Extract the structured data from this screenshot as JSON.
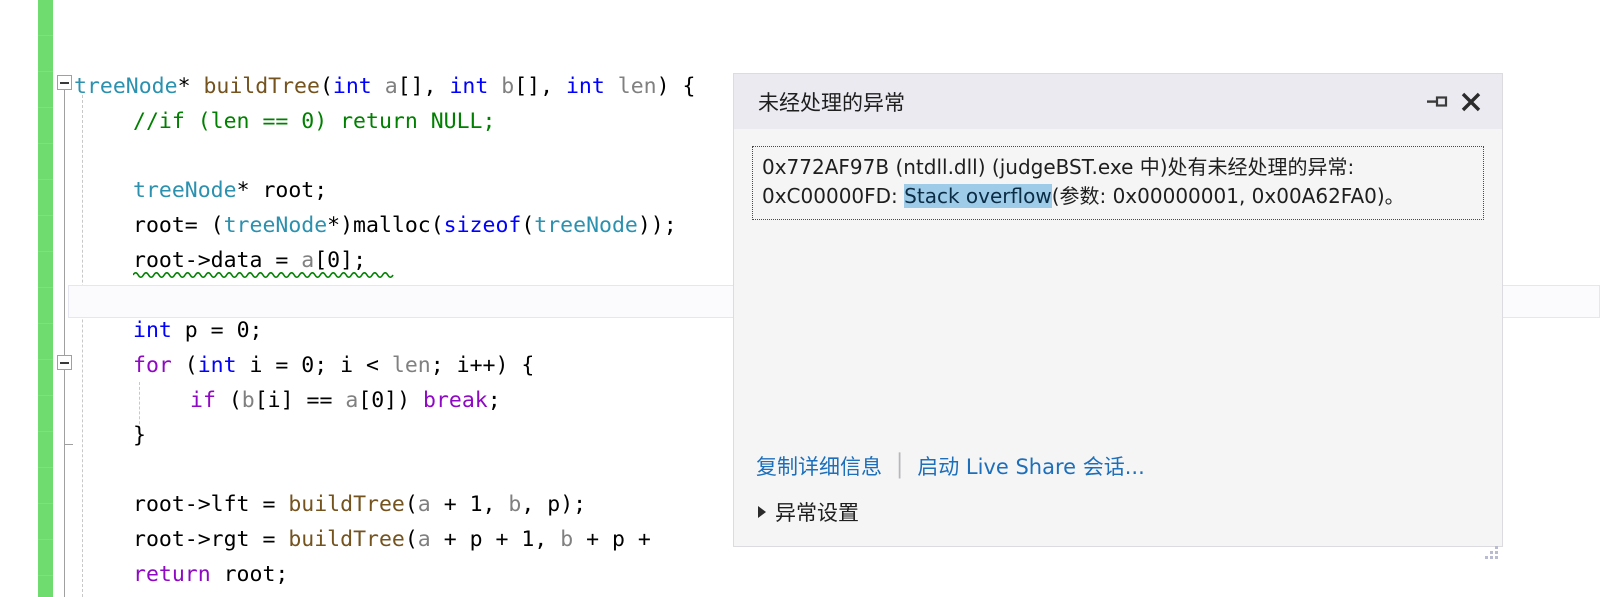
{
  "editor": {
    "language": "cpp",
    "lines": [
      {
        "indent": 0,
        "tokens": [
          {
            "t": "treeNode",
            "c": "type"
          },
          {
            "t": "* ",
            "c": "plain"
          },
          {
            "t": "buildTree",
            "c": "fn"
          },
          {
            "t": "(",
            "c": "plain"
          },
          {
            "t": "int",
            "c": "kw"
          },
          {
            "t": " ",
            "c": "plain"
          },
          {
            "t": "a",
            "c": "param"
          },
          {
            "t": "[], ",
            "c": "plain"
          },
          {
            "t": "int",
            "c": "kw"
          },
          {
            "t": " ",
            "c": "plain"
          },
          {
            "t": "b",
            "c": "param"
          },
          {
            "t": "[], ",
            "c": "plain"
          },
          {
            "t": "int",
            "c": "kw"
          },
          {
            "t": " ",
            "c": "plain"
          },
          {
            "t": "len",
            "c": "param"
          },
          {
            "t": ") {",
            "c": "plain"
          }
        ]
      },
      {
        "indent": 1,
        "tokens": [
          {
            "t": "//if (len == 0) return NULL;",
            "c": "comment"
          }
        ]
      },
      {
        "indent": 1,
        "tokens": []
      },
      {
        "indent": 1,
        "tokens": [
          {
            "t": "treeNode",
            "c": "type"
          },
          {
            "t": "* root;",
            "c": "plain"
          }
        ]
      },
      {
        "indent": 1,
        "tokens": [
          {
            "t": "root= (",
            "c": "plain"
          },
          {
            "t": "treeNode",
            "c": "type"
          },
          {
            "t": "*)malloc(",
            "c": "plain"
          },
          {
            "t": "sizeof",
            "c": "kw"
          },
          {
            "t": "(",
            "c": "plain"
          },
          {
            "t": "treeNode",
            "c": "type"
          },
          {
            "t": "));",
            "c": "plain"
          }
        ]
      },
      {
        "indent": 1,
        "tokens": [
          {
            "t": "root->data = ",
            "c": "plain"
          },
          {
            "t": "a",
            "c": "param"
          },
          {
            "t": "[0];",
            "c": "plain"
          }
        ]
      },
      {
        "indent": 1,
        "tokens": []
      },
      {
        "indent": 1,
        "tokens": [
          {
            "t": "int",
            "c": "kw"
          },
          {
            "t": " p = 0;",
            "c": "plain"
          }
        ]
      },
      {
        "indent": 1,
        "tokens": [
          {
            "t": "for",
            "c": "kw2"
          },
          {
            "t": " (",
            "c": "plain"
          },
          {
            "t": "int",
            "c": "kw"
          },
          {
            "t": " i = 0; i < ",
            "c": "plain"
          },
          {
            "t": "len",
            "c": "param"
          },
          {
            "t": "; i++) {",
            "c": "plain"
          }
        ]
      },
      {
        "indent": 2,
        "tokens": [
          {
            "t": "if",
            "c": "kw2"
          },
          {
            "t": " (",
            "c": "plain"
          },
          {
            "t": "b",
            "c": "param"
          },
          {
            "t": "[i] == ",
            "c": "plain"
          },
          {
            "t": "a",
            "c": "param"
          },
          {
            "t": "[0]) ",
            "c": "plain"
          },
          {
            "t": "break",
            "c": "kw2"
          },
          {
            "t": ";",
            "c": "plain"
          }
        ]
      },
      {
        "indent": 1,
        "tokens": [
          {
            "t": "}",
            "c": "plain"
          }
        ]
      },
      {
        "indent": 1,
        "tokens": []
      },
      {
        "indent": 1,
        "tokens": [
          {
            "t": "root->lft = ",
            "c": "plain"
          },
          {
            "t": "buildTree",
            "c": "fn"
          },
          {
            "t": "(",
            "c": "plain"
          },
          {
            "t": "a",
            "c": "param"
          },
          {
            "t": " + 1, ",
            "c": "plain"
          },
          {
            "t": "b",
            "c": "param"
          },
          {
            "t": ", p);",
            "c": "plain"
          }
        ]
      },
      {
        "indent": 1,
        "tokens": [
          {
            "t": "root->rgt = ",
            "c": "plain"
          },
          {
            "t": "buildTree",
            "c": "fn"
          },
          {
            "t": "(",
            "c": "plain"
          },
          {
            "t": "a",
            "c": "param"
          },
          {
            "t": " + p + 1, ",
            "c": "plain"
          },
          {
            "t": "b",
            "c": "param"
          },
          {
            "t": " + p + ",
            "c": "plain"
          }
        ]
      },
      {
        "indent": 1,
        "tokens": [
          {
            "t": "return",
            "c": "kw2"
          },
          {
            "t": " root;",
            "c": "plain"
          }
        ]
      }
    ],
    "change_bar_color": "#6fdc6f",
    "squiggle_color": "#008000",
    "current_line_index": 6
  },
  "dialog": {
    "title": "未经处理的异常",
    "pin_icon": "pin-icon",
    "close_icon": "close-icon",
    "message": {
      "line1_pre": "0x772AF97B (ntdll.dll) (judgeBST.exe 中)处有未经处理的异常:",
      "line2_pre": "0xC00000FD: ",
      "line2_highlight": "Stack overflow",
      "line2_post": "(参数: 0x00000001, 0x00A62FA0)。",
      "highlight_color": "#9ecbe8"
    },
    "links": {
      "copy_details": "复制详细信息",
      "separator": "│",
      "live_share": "启动 Live Share 会话..."
    },
    "expander_label": "异常设置",
    "link_color": "#1d6fbb"
  }
}
